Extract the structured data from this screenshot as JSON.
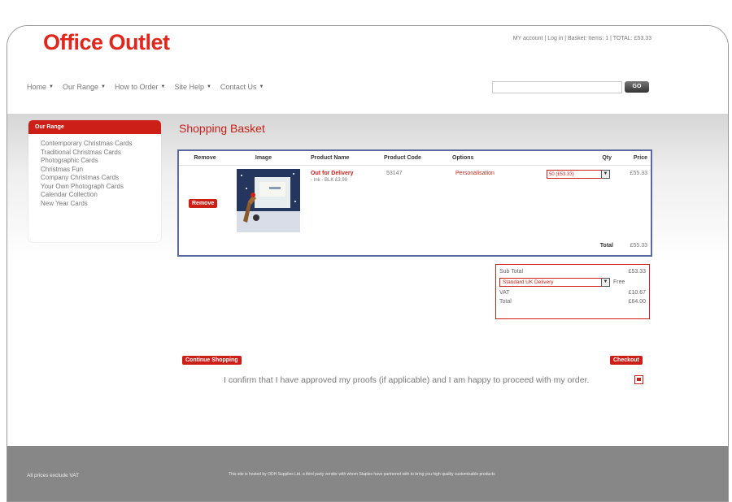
{
  "header": {
    "logo": "Office Outlet",
    "account_links": "MY account | Log in | Basket: Items: 1 | TOTAL: £53.33"
  },
  "nav": {
    "items": [
      "Home",
      "Our Range",
      "How to Order",
      "Site Help",
      "Contact Us"
    ]
  },
  "search": {
    "placeholder": "",
    "button_label": "GO"
  },
  "sidebar": {
    "title": "Our Range",
    "items": [
      "Contemporary Christmas Cards",
      "Traditional Christmas Cards",
      "Photographic Cards",
      "Christmas Fun",
      "Company Christmas Cards",
      "Your Own Photograph Cards",
      "Calendar Collection",
      "New Year Cards"
    ]
  },
  "main": {
    "title": "Shopping Basket",
    "basket": {
      "headers": [
        "Remove",
        "Image",
        "Product Name",
        "Product Code",
        "Options",
        "Qty",
        "Price"
      ],
      "row": {
        "remove_label": "Remove",
        "product_name": "Out for Delivery",
        "product_sub": "- Ink - BLK  £3.99",
        "product_code": "53147",
        "options": "Personalisation",
        "qty": "50 (£53.33)",
        "price": "£55.33"
      },
      "total_label": "Total",
      "total_value": "£55.33"
    },
    "totals": {
      "subtotal_label": "Sub Total",
      "subtotal_value": "£53.33",
      "delivery_option": "Standard UK Delivery",
      "delivery_value": "Free",
      "vat_label": "VAT",
      "vat_value": "£10.67",
      "total_label": "Total",
      "total_value": "£64.00"
    },
    "continue_label": "Continue Shopping",
    "checkout_label": "Checkout",
    "confirm_text": "I confirm that I have approved my proofs (if applicable) and I am happy to proceed with my order."
  },
  "footer": {
    "left": "All prices exclude VAT",
    "right": "This site is hosted by ODH Supplies Ltd. a third party vendor with whom Staples have partnered with to bring you high quality customisable products"
  },
  "colors": {
    "brand_red": "#cc1f18",
    "footer_grey": "#878787",
    "basket_border": "#5a6aa0"
  }
}
